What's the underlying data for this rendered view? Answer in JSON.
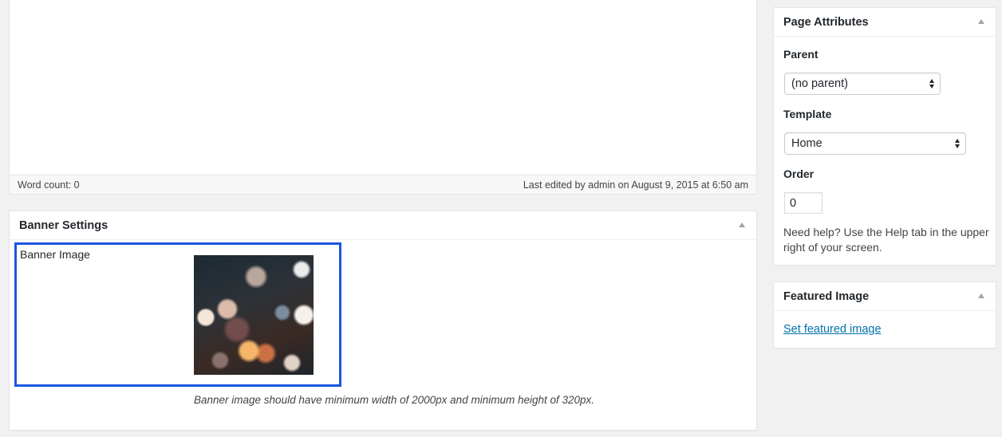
{
  "editor": {
    "word_count": "Word count: 0",
    "last_edited": "Last edited by admin on August 9, 2015 at 6:50 am"
  },
  "banner_settings": {
    "title": "Banner Settings",
    "field_label": "Banner Image",
    "description": "Banner image should have minimum width of 2000px and minimum height of 320px."
  },
  "page_attributes": {
    "title": "Page Attributes",
    "parent_label": "Parent",
    "parent_value": "(no parent)",
    "template_label": "Template",
    "template_value": "Home",
    "order_label": "Order",
    "order_value": "0",
    "help_text": "Need help? Use the Help tab in the upper right of your screen."
  },
  "featured_image": {
    "title": "Featured Image",
    "link": "Set featured image"
  },
  "colors": {
    "highlight_border": "#1b55e2",
    "link": "#0073aa"
  }
}
